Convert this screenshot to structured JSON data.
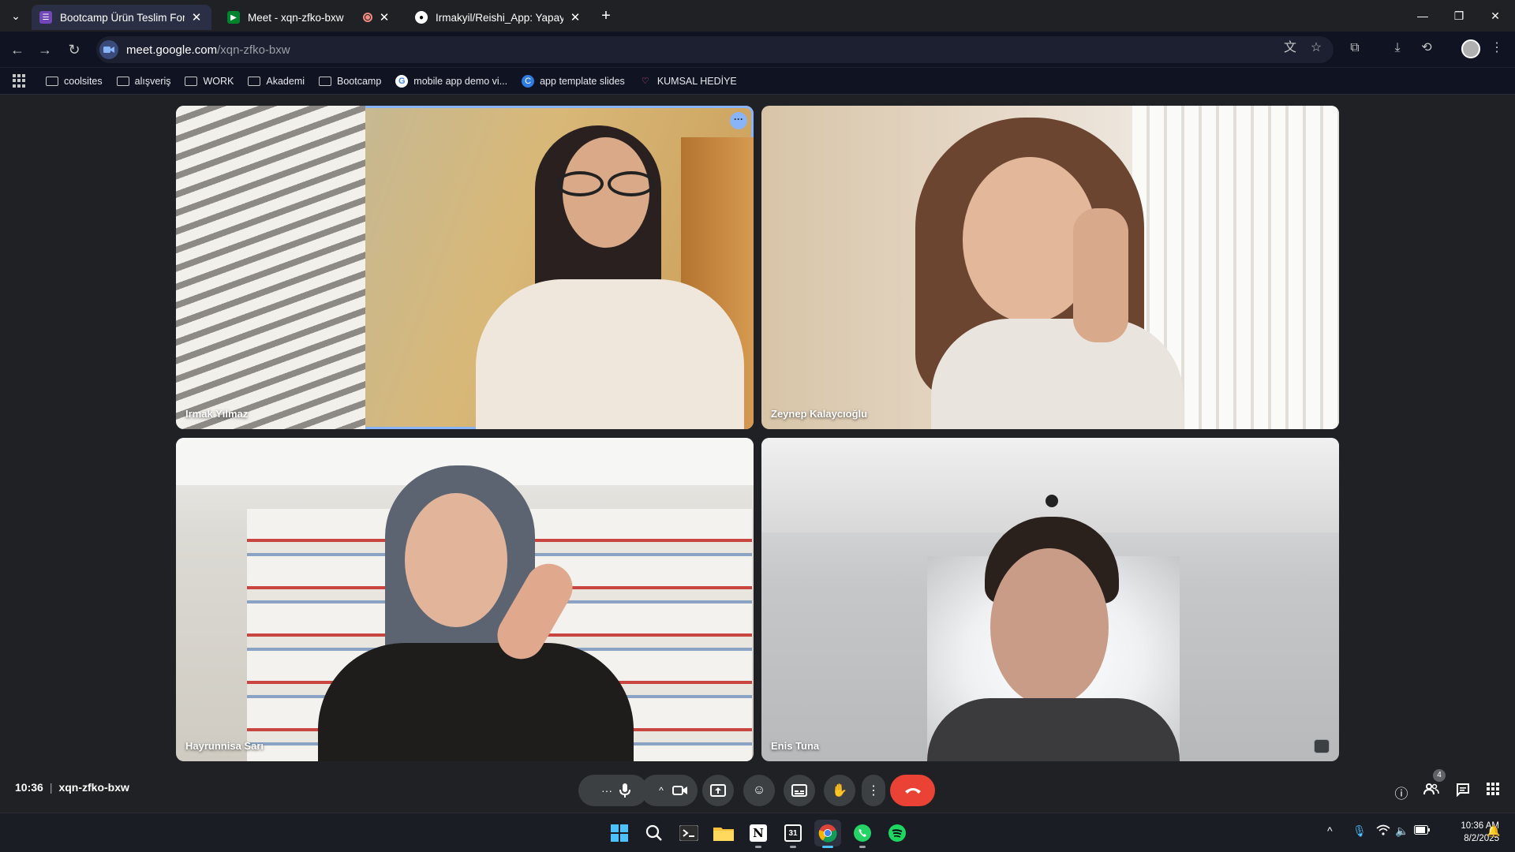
{
  "browser": {
    "tabs": [
      {
        "title": "Bootcamp Ürün Teslim Formu",
        "favicon": "forms-icon"
      },
      {
        "title": "Meet - xqn-zfko-bxw",
        "favicon": "meet-icon",
        "recording": true
      },
      {
        "title": "Irmakyil/Reishi_App: Yapay Zek",
        "favicon": "github-icon"
      }
    ],
    "url_host": "meet.google.com",
    "url_path": "/xqn-zfko-bxw",
    "bookmarks": [
      {
        "label": "coolsites",
        "icon": "folder-icon"
      },
      {
        "label": "alışveriş",
        "icon": "folder-icon"
      },
      {
        "label": "WORK",
        "icon": "folder-icon"
      },
      {
        "label": "Akademi",
        "icon": "folder-icon"
      },
      {
        "label": "Bootcamp",
        "icon": "folder-icon"
      },
      {
        "label": "mobile app demo vi...",
        "icon": "google-icon"
      },
      {
        "label": "app template slides",
        "icon": "canva-icon"
      },
      {
        "label": "KUMSAL HEDİYE",
        "icon": "heart-icon"
      }
    ]
  },
  "meet": {
    "participants": [
      {
        "name": "Irmak Yılmaz",
        "speaking": true
      },
      {
        "name": "Zeynep Kalaycıoğlu"
      },
      {
        "name": "Hayrunnisa Sarı"
      },
      {
        "name": "Enis Tuna"
      }
    ],
    "time": "10:36",
    "separator": "|",
    "meeting_code": "xqn-zfko-bxw",
    "people_count": "4"
  },
  "taskbar": {
    "apps": [
      "windows-start-icon",
      "search-icon",
      "terminal-icon",
      "file-explorer-icon",
      "notion-icon",
      "calendar-icon",
      "chrome-icon",
      "whatsapp-icon",
      "spotify-icon"
    ],
    "calendar_day": "31",
    "clock_time": "10:36 AM",
    "clock_date": "8/2/2025"
  },
  "colors": {
    "accent": "#8ab4f8",
    "end_call": "#ea4335",
    "meet_bg": "#202124"
  }
}
